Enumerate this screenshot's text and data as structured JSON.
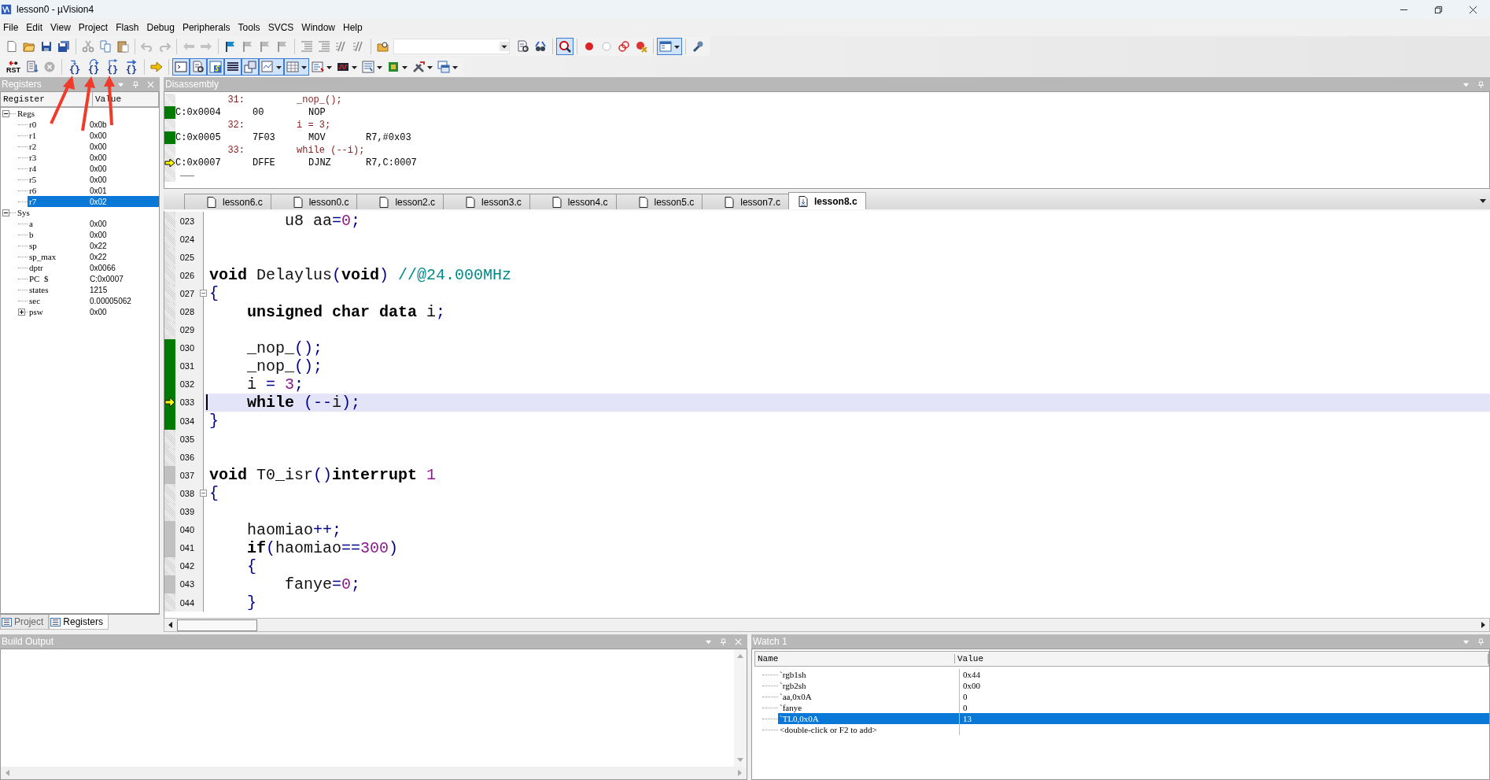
{
  "window": {
    "title": "lesson0  - µVision4"
  },
  "menu": [
    "File",
    "Edit",
    "View",
    "Project",
    "Flash",
    "Debug",
    "Peripherals",
    "Tools",
    "SVCS",
    "Window",
    "Help"
  ],
  "debug_toolbar": [
    {
      "kind": "reset",
      "label": "RST"
    },
    {
      "kind": "step_into",
      "label": "{}"
    },
    {
      "kind": "step_over",
      "label": "{}"
    },
    {
      "kind": "step_out",
      "label": "{}"
    },
    {
      "kind": "run_to_cursor",
      "label": "{}"
    }
  ],
  "registers": {
    "title": "Registers",
    "columns": [
      "Register",
      "Value"
    ],
    "tree": [
      {
        "name": "Regs",
        "expanded": true,
        "selected": false,
        "children": [
          {
            "name": "r0",
            "value": "0x0b",
            "selected": false
          },
          {
            "name": "r1",
            "value": "0x00",
            "selected": false
          },
          {
            "name": "r2",
            "value": "0x00",
            "selected": false
          },
          {
            "name": "r3",
            "value": "0x00",
            "selected": false
          },
          {
            "name": "r4",
            "value": "0x00",
            "selected": false
          },
          {
            "name": "r5",
            "value": "0x00",
            "selected": false
          },
          {
            "name": "r6",
            "value": "0x01",
            "selected": false
          },
          {
            "name": "r7",
            "value": "0x02",
            "selected": true
          }
        ]
      },
      {
        "name": "Sys",
        "expanded": true,
        "selected": false,
        "children": [
          {
            "name": "a",
            "value": "0x00",
            "selected": false
          },
          {
            "name": "b",
            "value": "0x00",
            "selected": false
          },
          {
            "name": "sp",
            "value": "0x22",
            "selected": false
          },
          {
            "name": "sp_max",
            "value": "0x22",
            "selected": false
          },
          {
            "name": "dptr",
            "value": "0x0066",
            "selected": false
          },
          {
            "name": "PC  $",
            "value": "C:0x0007",
            "selected": false
          },
          {
            "name": "states",
            "value": "1215",
            "selected": false
          },
          {
            "name": "sec",
            "value": "0.00005062",
            "selected": false
          },
          {
            "name": "psw",
            "value": "0x00",
            "selected": false,
            "expanded": false
          }
        ]
      }
    ],
    "tabs": [
      {
        "label": "Project",
        "selected": false
      },
      {
        "label": "Registers",
        "selected": true
      }
    ]
  },
  "disassembly": {
    "title": "Disassembly",
    "rows": [
      {
        "kind": "source",
        "line": "31:",
        "code": "_nop_();"
      },
      {
        "kind": "asm",
        "executed": true,
        "current": false,
        "address": "C:0x0004",
        "opcode": "00",
        "mnemonic": "NOP"
      },
      {
        "kind": "source",
        "line": "32:",
        "code": "i = 3;"
      },
      {
        "kind": "asm",
        "executed": true,
        "current": false,
        "address": "C:0x0005",
        "opcode": "7F03",
        "mnemonic": "MOV",
        "operand": "R7,#0x03"
      },
      {
        "kind": "source",
        "line": "33:",
        "code": "while (--i);"
      },
      {
        "kind": "asm",
        "executed": false,
        "current": true,
        "address": "C:0x0007",
        "opcode": "DFFE",
        "mnemonic": "DJNZ",
        "operand": "R7,C:0007"
      }
    ]
  },
  "editor_tabs": [
    {
      "label": "lesson6.c",
      "selected": false
    },
    {
      "label": "lesson0.c",
      "selected": false
    },
    {
      "label": "lesson2.c",
      "selected": false
    },
    {
      "label": "lesson3.c",
      "selected": false
    },
    {
      "label": "lesson4.c",
      "selected": false
    },
    {
      "label": "lesson5.c",
      "selected": false
    },
    {
      "label": "lesson7.c",
      "selected": false
    },
    {
      "label": "lesson8.c",
      "selected": true
    }
  ],
  "code": [
    {
      "n": "023",
      "executed": false,
      "covered": false,
      "current": false,
      "fold": false,
      "tokens": [
        {
          "text": "        u8 aa",
          "kind": "plain"
        },
        {
          "text": "=",
          "kind": "op"
        },
        {
          "text": "0",
          "kind": "num"
        },
        {
          "text": ";",
          "kind": "op"
        }
      ]
    },
    {
      "n": "024",
      "executed": false,
      "covered": false,
      "current": false,
      "fold": false
    },
    {
      "n": "025",
      "executed": false,
      "covered": false,
      "current": false,
      "fold": false
    },
    {
      "n": "026",
      "executed": false,
      "covered": false,
      "current": false,
      "fold": false,
      "tokens": [
        {
          "text": "void",
          "kind": "kw"
        },
        {
          "text": " Delaylus",
          "kind": "plain"
        },
        {
          "text": "(",
          "kind": "op"
        },
        {
          "text": "void",
          "kind": "kw"
        },
        {
          "text": ")",
          "kind": "op"
        },
        {
          "text": " //@24.000MHz",
          "kind": "comment"
        }
      ]
    },
    {
      "n": "027",
      "executed": false,
      "covered": false,
      "current": false,
      "fold": true,
      "tokens": [
        {
          "text": "{",
          "kind": "op"
        }
      ]
    },
    {
      "n": "028",
      "executed": false,
      "covered": false,
      "current": false,
      "fold": false,
      "tokens": [
        {
          "text": "    unsigned char data",
          "kind": "kw"
        },
        {
          "text": " i",
          "kind": "plain"
        },
        {
          "text": ";",
          "kind": "op"
        }
      ]
    },
    {
      "n": "029",
      "executed": false,
      "covered": false,
      "current": false,
      "fold": false
    },
    {
      "n": "030",
      "executed": true,
      "covered": false,
      "current": false,
      "fold": false,
      "tokens": [
        {
          "text": "    _nop_",
          "kind": "plain"
        },
        {
          "text": "();",
          "kind": "op"
        }
      ]
    },
    {
      "n": "031",
      "executed": true,
      "covered": false,
      "current": false,
      "fold": false,
      "tokens": [
        {
          "text": "    _nop_",
          "kind": "plain"
        },
        {
          "text": "();",
          "kind": "op"
        }
      ]
    },
    {
      "n": "032",
      "executed": true,
      "covered": false,
      "current": false,
      "fold": false,
      "tokens": [
        {
          "text": "    i ",
          "kind": "plain"
        },
        {
          "text": "=",
          "kind": "op"
        },
        {
          "text": " 3",
          "kind": "num"
        },
        {
          "text": ";",
          "kind": "op"
        }
      ]
    },
    {
      "n": "033",
      "executed": true,
      "covered": false,
      "current": true,
      "fold": false,
      "tokens": [
        {
          "text": "    while",
          "kind": "kw"
        },
        {
          "text": " (--",
          "kind": "op"
        },
        {
          "text": "i",
          "kind": "plain"
        },
        {
          "text": ");",
          "kind": "op"
        }
      ]
    },
    {
      "n": "034",
      "executed": true,
      "covered": false,
      "current": false,
      "fold": false,
      "tokens": [
        {
          "text": "}",
          "kind": "op"
        }
      ]
    },
    {
      "n": "035",
      "executed": false,
      "covered": false,
      "current": false,
      "fold": false
    },
    {
      "n": "036",
      "executed": false,
      "covered": false,
      "current": false,
      "fold": false
    },
    {
      "n": "037",
      "executed": false,
      "covered": true,
      "current": false,
      "fold": false,
      "tokens": [
        {
          "text": "void",
          "kind": "kw"
        },
        {
          "text": " T0_isr",
          "kind": "plain"
        },
        {
          "text": "()",
          "kind": "op"
        },
        {
          "text": "interrupt",
          "kind": "kw"
        },
        {
          "text": " 1",
          "kind": "num"
        }
      ]
    },
    {
      "n": "038",
      "executed": false,
      "covered": false,
      "current": false,
      "fold": true,
      "tokens": [
        {
          "text": "{",
          "kind": "op"
        }
      ]
    },
    {
      "n": "039",
      "executed": false,
      "covered": false,
      "current": false,
      "fold": false
    },
    {
      "n": "040",
      "executed": false,
      "covered": true,
      "current": false,
      "fold": false,
      "tokens": [
        {
          "text": "    haomiao",
          "kind": "plain"
        },
        {
          "text": "++;",
          "kind": "op"
        }
      ]
    },
    {
      "n": "041",
      "executed": false,
      "covered": true,
      "current": false,
      "fold": false,
      "tokens": [
        {
          "text": "    if",
          "kind": "kw"
        },
        {
          "text": "(",
          "kind": "op"
        },
        {
          "text": "haomiao",
          "kind": "plain"
        },
        {
          "text": "==",
          "kind": "op"
        },
        {
          "text": "300",
          "kind": "num"
        },
        {
          "text": ")",
          "kind": "op"
        }
      ]
    },
    {
      "n": "042",
      "executed": false,
      "covered": false,
      "current": false,
      "fold": false,
      "tokens": [
        {
          "text": "    {",
          "kind": "op"
        }
      ]
    },
    {
      "n": "043",
      "executed": false,
      "covered": true,
      "current": false,
      "fold": false,
      "tokens": [
        {
          "text": "        fanye",
          "kind": "plain"
        },
        {
          "text": "=",
          "kind": "op"
        },
        {
          "text": "0",
          "kind": "num"
        },
        {
          "text": ";",
          "kind": "op"
        }
      ]
    },
    {
      "n": "044",
      "executed": false,
      "covered": false,
      "current": false,
      "fold": false,
      "tokens": [
        {
          "text": "    }",
          "kind": "op"
        }
      ]
    }
  ],
  "build_output": {
    "title": "Build Output"
  },
  "watch": {
    "title": "Watch 1",
    "columns": [
      "Name",
      "Value"
    ],
    "rows": [
      {
        "name": "`rgb1sh",
        "value": "0x44",
        "selected": false
      },
      {
        "name": "`rgb2sh",
        "value": "0x00",
        "selected": false
      },
      {
        "name": "`aa,0x0A",
        "value": "0",
        "selected": false
      },
      {
        "name": "`fanye",
        "value": "0",
        "selected": false
      },
      {
        "name": "`TL0,0x0A",
        "value": "13",
        "selected": true
      }
    ],
    "hint": "<double-click or F2 to add>"
  }
}
